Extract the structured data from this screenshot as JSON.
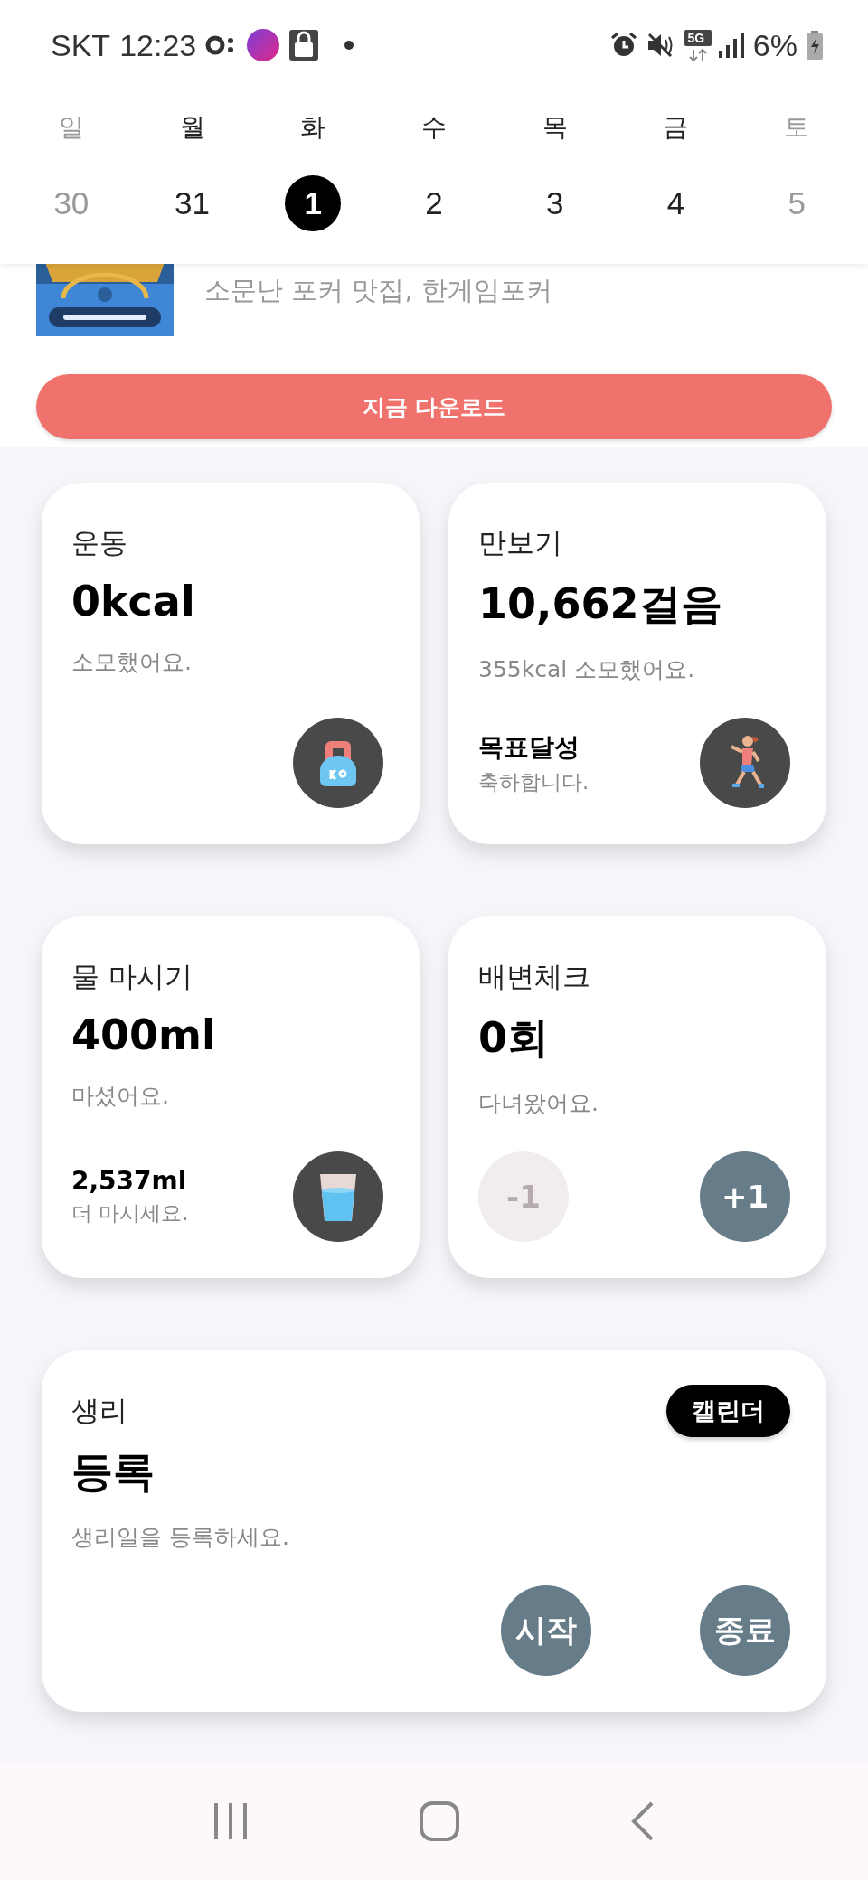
{
  "status_bar": {
    "carrier": "SKT",
    "time": "12:23",
    "network": "5G",
    "battery": "6%"
  },
  "week": [
    {
      "weekday": "일",
      "date": "30",
      "muted": true,
      "selected": false
    },
    {
      "weekday": "월",
      "date": "31",
      "muted": false,
      "selected": false
    },
    {
      "weekday": "화",
      "date": "1",
      "muted": false,
      "selected": true
    },
    {
      "weekday": "수",
      "date": "2",
      "muted": false,
      "selected": false
    },
    {
      "weekday": "목",
      "date": "3",
      "muted": false,
      "selected": false
    },
    {
      "weekday": "금",
      "date": "4",
      "muted": false,
      "selected": false
    },
    {
      "weekday": "토",
      "date": "5",
      "muted": true,
      "selected": false
    }
  ],
  "ad": {
    "text": "소문난 포커 맛집, 한게임포커",
    "button": "지금 다운로드"
  },
  "cards": [
    {
      "kind": "icon",
      "title": "운동",
      "value": "0kcal",
      "note": "소모했어요."
    },
    {
      "kind": "icon",
      "title": "만보기",
      "value": "10,662걸음",
      "note": "355kcal 소모했어요.",
      "goal": {
        "value": "목표달성",
        "note": "축하합니다."
      }
    },
    {
      "kind": "icon",
      "title": "물 마시기",
      "value": "400ml",
      "note": "마셨어요.",
      "goal": {
        "value": "2,537ml",
        "note": "더 마시세요."
      }
    },
    {
      "kind": "counter",
      "title": "배변체크",
      "value": "0회",
      "note": "다녀왔어요.",
      "buttons": [
        {
          "label": "-1",
          "disabled": true
        },
        {
          "label": "+1",
          "disabled": false
        }
      ]
    },
    {
      "kind": "period",
      "title": "생리",
      "value": "등록",
      "note": "생리일을 등록하세요.",
      "calendar_button": "캘린더",
      "buttons": [
        {
          "label": "시작",
          "disabled": false
        },
        {
          "label": "종료",
          "disabled": false
        }
      ]
    }
  ]
}
